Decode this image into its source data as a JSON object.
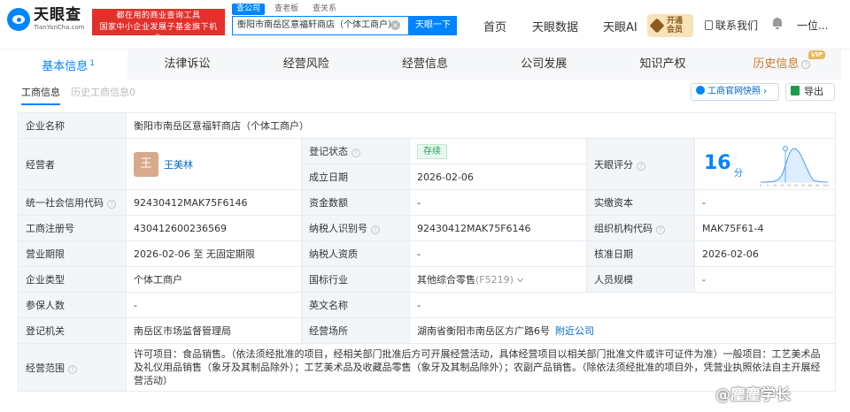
{
  "header": {
    "logo_cn": "天眼查",
    "logo_en": "TianYanCha.com",
    "slogan_line1": "都在用的商业查询工具",
    "slogan_line2": "国家中小企业发展子基金旗下机构",
    "search_tabs": [
      "查公司",
      "查老板",
      "查关系"
    ],
    "search_value": "衡阳市南岳区意福轩商店（个体工商户）",
    "search_button": "天眼一下",
    "nav": [
      "首页",
      "天眼数据",
      "天眼AI"
    ],
    "vip_line1": "开通",
    "vip_line2": "会员",
    "contact": "联系我们",
    "user": "一位..."
  },
  "main_tabs": [
    {
      "label": "基本信息",
      "count": "1"
    },
    {
      "label": "法律诉讼"
    },
    {
      "label": "经营风险"
    },
    {
      "label": "经营信息"
    },
    {
      "label": "公司发展"
    },
    {
      "label": "知识产权"
    },
    {
      "label": "历史信息",
      "tag": "VIP"
    }
  ],
  "sub_tabs": [
    "工商信息",
    "历史工商信息0"
  ],
  "actions": {
    "snapshot": "工商官网快照",
    "export": "导出"
  },
  "info": {
    "company_name_label": "企业名称",
    "company_name": "衡阳市南岳区意福轩商店（个体工商户）",
    "operator_label": "经营者",
    "operator_avatar": "王",
    "operator_name": "王美林",
    "reg_status_label": "登记状态",
    "reg_status": "存续",
    "score_label": "天眼评分",
    "score": "16",
    "score_unit": "分",
    "established_label": "成立日期",
    "established": "2026-02-06",
    "credit_code_label": "统一社会信用代码",
    "credit_code": "92430412MAK75F6146",
    "capital_label": "资金数额",
    "capital": "-",
    "paid_capital_label": "实缴资本",
    "paid_capital": "-",
    "reg_no_label": "工商注册号",
    "reg_no": "430412600236569",
    "taxpayer_id_label": "纳税人识别号",
    "taxpayer_id": "92430412MAK75F6146",
    "org_code_label": "组织机构代码",
    "org_code": "MAK75F61-4",
    "term_label": "营业期限",
    "term": "2026-02-06 至 无固定期限",
    "taxpayer_qual_label": "纳税人资质",
    "taxpayer_qual": "-",
    "approved_label": "核准日期",
    "approved": "2026-02-06",
    "type_label": "企业类型",
    "type": "个体工商户",
    "industry_label": "国标行业",
    "industry": "其他综合零售",
    "industry_code": "(F5219)",
    "staff_label": "人员规模",
    "staff": "-",
    "insured_label": "参保人数",
    "insured": "-",
    "english_label": "英文名称",
    "english": "-",
    "authority_label": "登记机关",
    "authority": "南岳区市场监督管理局",
    "address_label": "经营场所",
    "address": "湖南省衡阳市南岳区方广路6号",
    "nearby": "附近公司",
    "scope_label": "经营范围",
    "scope": "许可项目：食品销售。（依法须经批准的项目，经相关部门批准后方可开展经营活动，具体经营项目以相关部门批准文件或许可证件为准）一般项目：工艺美术品及礼仪用品销售（象牙及其制品除外）；工艺美术品及收藏品零售（象牙及其制品除外）；农副产品销售。（除依法须经批准的项目外，凭营业执照依法自主开展经营活动）"
  },
  "watermark": "@麈麈学长",
  "colors": {
    "accent": "#0084ff",
    "status_green": "#22a35a",
    "slogan_red": "#e4302b",
    "history_gold": "#c97d2b"
  }
}
